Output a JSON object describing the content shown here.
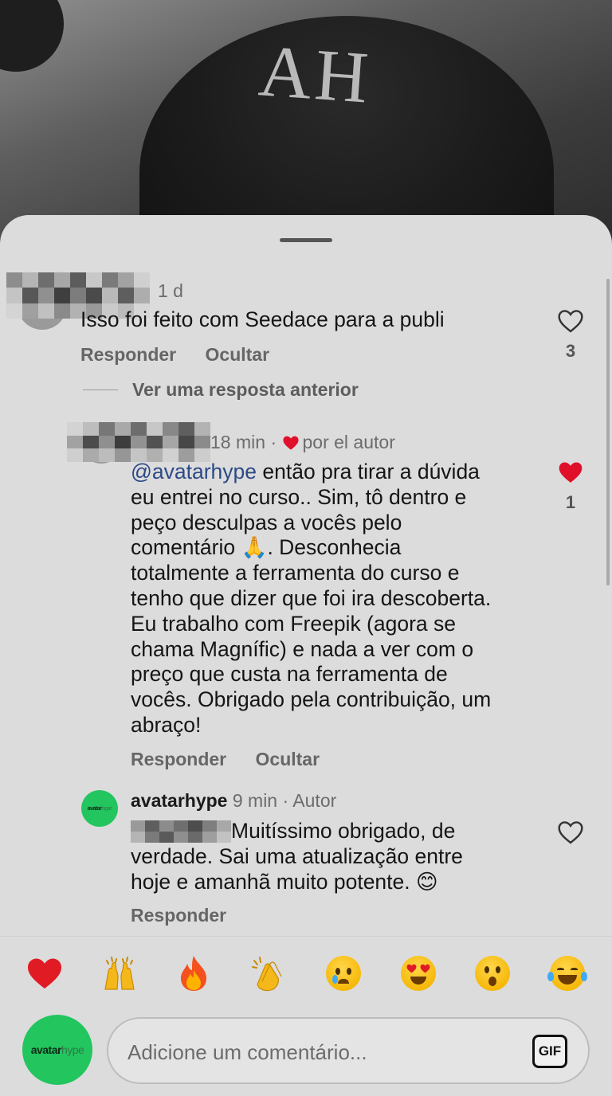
{
  "background": {
    "cap_text": "AH"
  },
  "comments": [
    {
      "time": "1 d",
      "text": "Isso foi feito com Seedace para a publi",
      "actions": {
        "reply": "Responder",
        "hide": "Ocultar"
      },
      "likes": "3",
      "liked": false
    }
  ],
  "more_replies": "Ver uma resposta anterior",
  "reply_1": {
    "time": "18 min",
    "separator": "·",
    "liked_by_author": "por el autor",
    "mention": "@avatarhype",
    "lines": [
      " então pra tirar a dúvida",
      "eu entrei no curso.. Sim, tô dentro e",
      "peço desculpas a vocês pelo",
      "comentário 🙏. Desconhecia",
      "totalmente a ferramenta do curso e",
      "tenho que dizer que foi ira descoberta.",
      "Eu trabalho com Freepik (agora se",
      "chama Magnífic) e nada a ver com o",
      "preço que custa na ferramenta de",
      "vocês. Obrigado pela contribuição, um",
      "abraço!"
    ],
    "actions": {
      "reply": "Responder",
      "hide": "Ocultar"
    },
    "likes": "1",
    "liked": true
  },
  "reply_2": {
    "username": "avatarhype",
    "time": "9 min",
    "separator": "·",
    "badge": "Autor",
    "lines": [
      " Muitíssimo obrigado, de",
      "verdade. Sai uma atualização entre",
      "hoje e amanhã muito potente. 😊"
    ],
    "actions": {
      "reply": "Responder"
    },
    "liked": false
  },
  "brand": {
    "logo_dark": "avatar",
    "logo_light": "hype"
  },
  "reactions": [
    "heart",
    "raised-hands",
    "fire",
    "clapping",
    "crying",
    "heart-eyes",
    "surprised",
    "laughing"
  ],
  "composer": {
    "placeholder": "Adicione um comentário...",
    "gif_label": "GIF"
  },
  "colors": {
    "sheet": "#dcdcdc",
    "like_red": "#e0102b",
    "brand_green": "#22c55e",
    "mention": "#2c4a86"
  }
}
